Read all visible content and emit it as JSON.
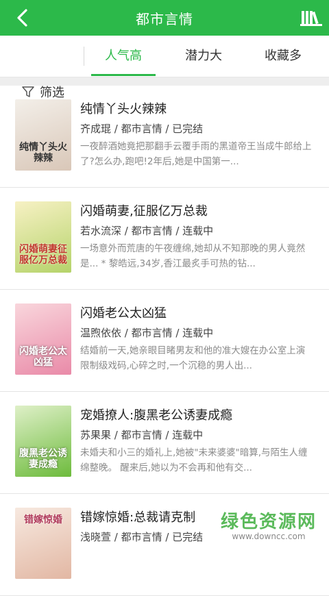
{
  "header": {
    "title": "都市言情"
  },
  "filter": {
    "label": "筛选"
  },
  "tabs": [
    {
      "label": "人气高",
      "active": true
    },
    {
      "label": "潜力大",
      "active": false
    },
    {
      "label": "收藏多",
      "active": false
    }
  ],
  "books": [
    {
      "title": "纯情丫头火辣辣",
      "meta": "齐成琨 / 都市言情 / 已完结",
      "desc": "一夜醉酒她竟把那翻手云覆手雨的黑道帝王当成牛郎给上了?怎么办,跑吧!2年后,她是中国第一...",
      "cover_text": "纯情丫头火辣辣",
      "cover_colors": [
        "#f3efe9",
        "#d9c7b8"
      ]
    },
    {
      "title": "闪婚萌妻,征服亿万总裁",
      "meta": "若水流深 / 都市言情 / 连载中",
      "desc": "一场意外而荒唐的午夜缠绵,她却从不知那晚的男人竟然是... * 黎皓远,34岁,香江最炙手可热的钻...",
      "cover_text": "闪婚萌妻征服亿万总裁",
      "cover_colors": [
        "#f7f1c4",
        "#b5d36a"
      ]
    },
    {
      "title": "闪婚老公太凶猛",
      "meta": "温煦依依 / 都市言情 / 连载中",
      "desc": "结婚前一天,她亲眼目睹男友和他的准大嫂在办公室上演限制级戏码,心碎之时,一个沉稳的男人出...",
      "cover_text": "闪婚老公太凶猛",
      "cover_colors": [
        "#f9d6dc",
        "#e98aa8"
      ]
    },
    {
      "title": "宠婚撩人:腹黑老公诱妻成瘾",
      "meta": "苏果果 / 都市言情 / 连载中",
      "desc": "未婚夫和小三的婚礼上,她被\"未来婆婆\"暗算,与陌生人缠绵整晚。 醒来后,她以为不会再和他有交...",
      "cover_text": "腹黑老公诱妻成瘾",
      "cover_colors": [
        "#dff0c8",
        "#6dbb3c"
      ]
    },
    {
      "title": "错嫁惊婚:总裁请克制",
      "meta": "浅晓萱 / 都市言情 / 已完结",
      "desc": "",
      "cover_text": "错嫁惊婚",
      "cover_colors": [
        "#f7e9e0",
        "#e2b7a3"
      ]
    }
  ],
  "watermark": {
    "main": "绿色资源网",
    "sub": "www.downcc.com"
  }
}
